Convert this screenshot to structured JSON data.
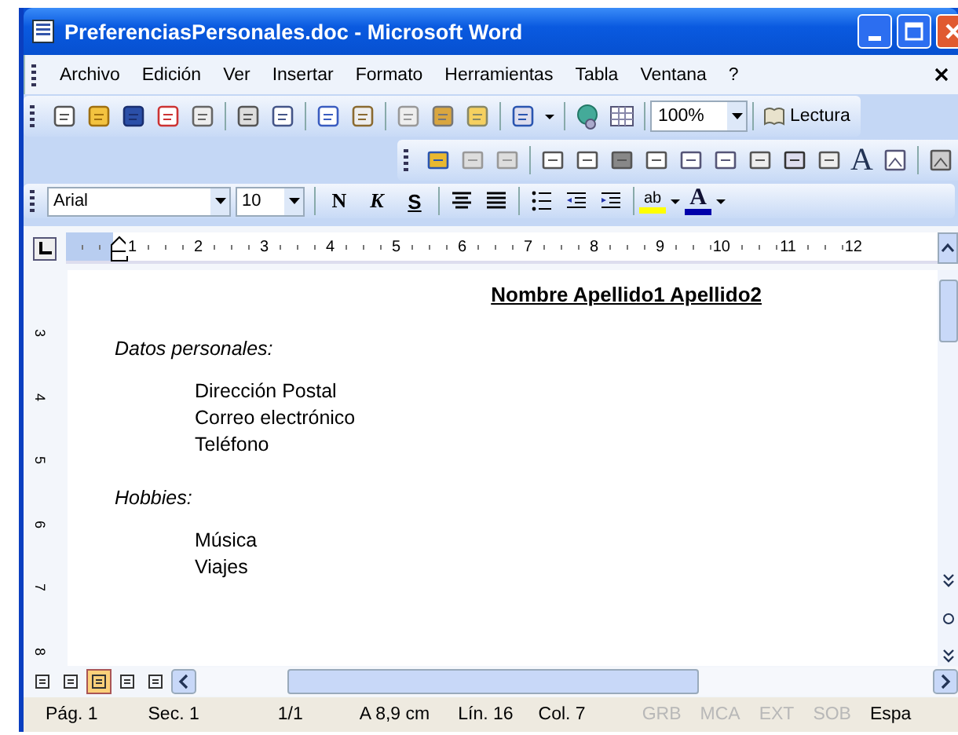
{
  "window": {
    "title": "PreferenciasPersonales.doc - Microsoft Word"
  },
  "menu": [
    "Archivo",
    "Edición",
    "Ver",
    "Insertar",
    "Formato",
    "Herramientas",
    "Tabla",
    "Ventana",
    "?"
  ],
  "standard_toolbar": {
    "zoom": "100%",
    "reading_button": "Lectura"
  },
  "forms_toolbar": {
    "wordart_label": "A"
  },
  "format_toolbar": {
    "font": "Arial",
    "size": "10",
    "bold": "N",
    "italic": "K",
    "underline": "S",
    "highlight_label": "ab",
    "font_color_label": "A"
  },
  "ruler": {
    "labels": [
      "1",
      "2",
      "3",
      "4",
      "5",
      "6",
      "7",
      "8",
      "9",
      "10",
      "11",
      "12"
    ],
    "vertical_labels": [
      "3",
      "4",
      "5",
      "6",
      "7",
      "8"
    ]
  },
  "document": {
    "heading": "Nombre Apellido1 Apellido2",
    "sections": [
      {
        "title": "Datos personales:",
        "items": [
          "Dirección Postal",
          "Correo electrónico",
          "Teléfono"
        ]
      },
      {
        "title": "Hobbies:",
        "items": [
          "Música",
          "Viajes"
        ]
      }
    ]
  },
  "view_buttons": [
    {
      "selected": false
    },
    {
      "selected": false
    },
    {
      "selected": true
    },
    {
      "selected": false
    },
    {
      "selected": false
    }
  ],
  "status_bar": [
    {
      "text": "Pág. 1",
      "disabled": false
    },
    {
      "text": "Sec. 1",
      "disabled": false
    },
    {
      "text": "1/1",
      "disabled": false
    },
    {
      "text": "A 8,9 cm",
      "disabled": false
    },
    {
      "text": "Lín. 16",
      "disabled": false
    },
    {
      "text": "Col. 7",
      "disabled": false
    },
    {
      "text": "GRB",
      "disabled": true
    },
    {
      "text": "MCA",
      "disabled": true
    },
    {
      "text": "EXT",
      "disabled": true
    },
    {
      "text": "SOB",
      "disabled": true
    },
    {
      "text": "Espa",
      "disabled": false
    }
  ]
}
